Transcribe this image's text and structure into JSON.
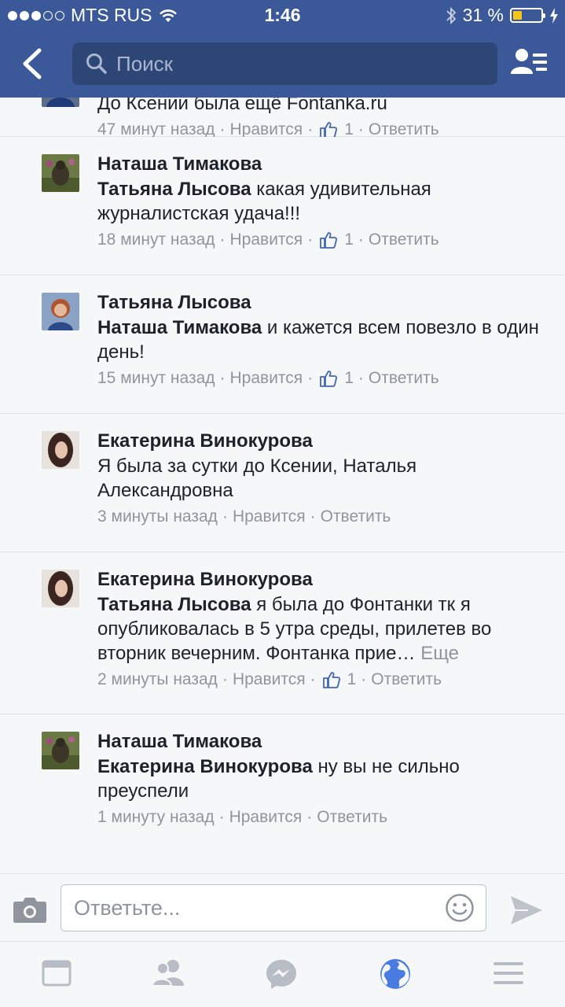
{
  "status_bar": {
    "carrier": "MTS RUS",
    "time": "1:46",
    "battery": "31 %",
    "battery_level": 0.31,
    "signal_bars_filled": 3,
    "signal_bars_total": 5
  },
  "header": {
    "search_placeholder": "Поиск",
    "back_icon": "chevron-left-icon",
    "friends_icon": "friends-list-icon"
  },
  "comments": [
    {
      "author": "",
      "text": "До Ксении была ещё Fontanka.ru",
      "time": "47 минут назад",
      "like_label": "Нравится",
      "likes": "1",
      "reply_label": "Ответить"
    },
    {
      "author": "Наташа Тимакова",
      "mention": "Татьяна Лысова",
      "text": " какая удивительная журналистская удача!!!",
      "time": "18 минут назад",
      "like_label": "Нравится",
      "likes": "1",
      "reply_label": "Ответить"
    },
    {
      "author": "Татьяна Лысова",
      "mention": "Наташа Тимакова",
      "text": " и кажется всем повезло в один день!",
      "time": "15 минут назад",
      "like_label": "Нравится",
      "likes": "1",
      "reply_label": "Ответить"
    },
    {
      "author": "Екатерина Винокурова",
      "text": "Я была за сутки до Ксении, Наталья Александровна",
      "time": "3 минуты назад",
      "like_label": "Нравится",
      "reply_label": "Ответить"
    },
    {
      "author": "Екатерина Винокурова",
      "mention": "Татьяна Лысова",
      "text": " я была до Фонтанки тк я опубликовалась в 5 утра среды, прилетев во вторник вечерним. Фонтанка прие…",
      "more_label": "Еще",
      "time": "2 минуты назад",
      "like_label": "Нравится",
      "likes": "1",
      "reply_label": "Ответить"
    },
    {
      "author": "Наташа Тимакова",
      "mention": "Екатерина Винокурова",
      "text": " ну вы не сильно преуспели",
      "time": "1 минуту назад",
      "like_label": "Нравится",
      "reply_label": "Ответить"
    }
  ],
  "reply_bar": {
    "placeholder": "Ответьте...",
    "camera_icon": "camera-icon",
    "emoji_icon": "emoji-icon",
    "send_icon": "send-icon"
  },
  "tabbar": {
    "tabs": [
      "news-feed-icon",
      "friends-icon",
      "messenger-icon",
      "globe-icon",
      "menu-icon"
    ],
    "active_tab": "globe-icon"
  },
  "colors": {
    "header_bg": "#3b5998",
    "search_bg": "#2e4675",
    "meta_text": "#90949c",
    "like_blue": "#4267b2",
    "active_tab": "#4a7be0",
    "inactive_tab": "#b8bcc4"
  }
}
